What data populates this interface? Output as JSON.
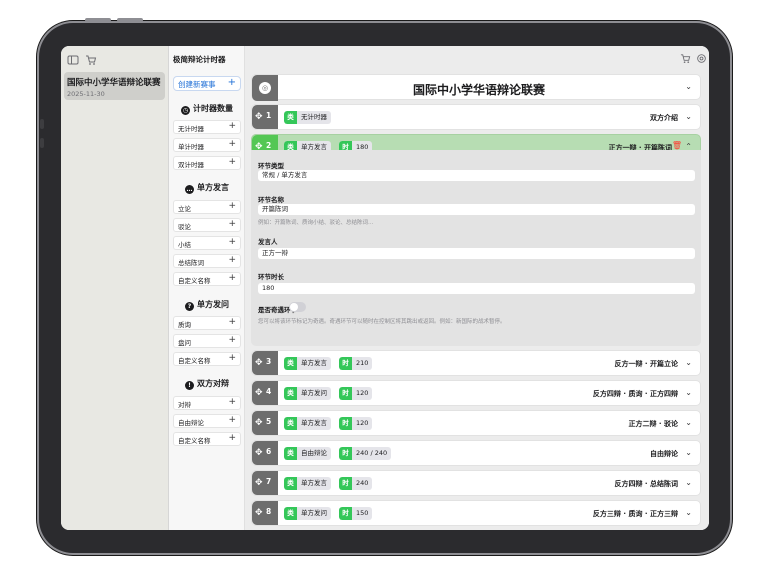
{
  "sidebar": {
    "competitions": [
      {
        "title": "国际中小学华语辩论联赛",
        "date": "2025-11-30"
      }
    ]
  },
  "templates": {
    "app_title": "极简辩论计时器",
    "new_competition": "创建新赛事",
    "groups": [
      {
        "title": "计时器数量",
        "icon": "clock-icon",
        "items": [
          "无计时器",
          "单计时器",
          "双计时器"
        ]
      },
      {
        "title": "单方发言",
        "icon": "speech-bubble-icon",
        "items": [
          "立论",
          "驳论",
          "小结",
          "总结陈词",
          "自定义名称"
        ]
      },
      {
        "title": "单方发问",
        "icon": "question-icon",
        "items": [
          "质询",
          "盘问",
          "自定义名称"
        ]
      },
      {
        "title": "双方对辩",
        "icon": "exclamation-icon",
        "items": [
          "对辩",
          "自由辩论",
          "自定义名称"
        ]
      }
    ]
  },
  "main": {
    "competition_title": "国际中小学华语辩论联赛",
    "type_key": "类",
    "time_key": "时",
    "segments": [
      {
        "num": "1",
        "type": "无计时器",
        "time": "",
        "speaker": "双方介绍"
      },
      {
        "num": "2",
        "type": "单方发言",
        "time": "180",
        "speaker": "正方一辩 · 开篇陈词"
      },
      {
        "num": "3",
        "type": "单方发言",
        "time": "210",
        "speaker": "反方一辩 · 开篇立论"
      },
      {
        "num": "4",
        "type": "单方发问",
        "time": "120",
        "speaker": "反方四辩 · 质询 · 正方四辩"
      },
      {
        "num": "5",
        "type": "单方发言",
        "time": "120",
        "speaker": "正方二辩 · 驳论"
      },
      {
        "num": "6",
        "type": "自由辩论",
        "time": "240 / 240",
        "speaker": "自由辩论"
      },
      {
        "num": "7",
        "type": "单方发言",
        "time": "240",
        "speaker": "反方四辩 · 总结陈词"
      },
      {
        "num": "8",
        "type": "单方发问",
        "time": "150",
        "speaker": "反方三辩 · 质询 · 正方三辩"
      }
    ],
    "detail": {
      "type_label": "环节类型",
      "type_value": "常规 / 单方发言",
      "name_label": "环节名称",
      "name_value": "开篇陈词",
      "name_hint": "例如：开篇陈词、质询小结、驳论、总结陈词…",
      "speaker_label": "发言人",
      "speaker_value": "正方一辩",
      "duration_label": "环节时长",
      "duration_value": "180",
      "optional_label": "是否奇遇环节",
      "optional_on": false,
      "optional_hint": "您可以将该环节标记为奇遇。奇遇环节可以随时在控制区将其跳出或返回。例如：新国际的战术暂停。"
    }
  }
}
